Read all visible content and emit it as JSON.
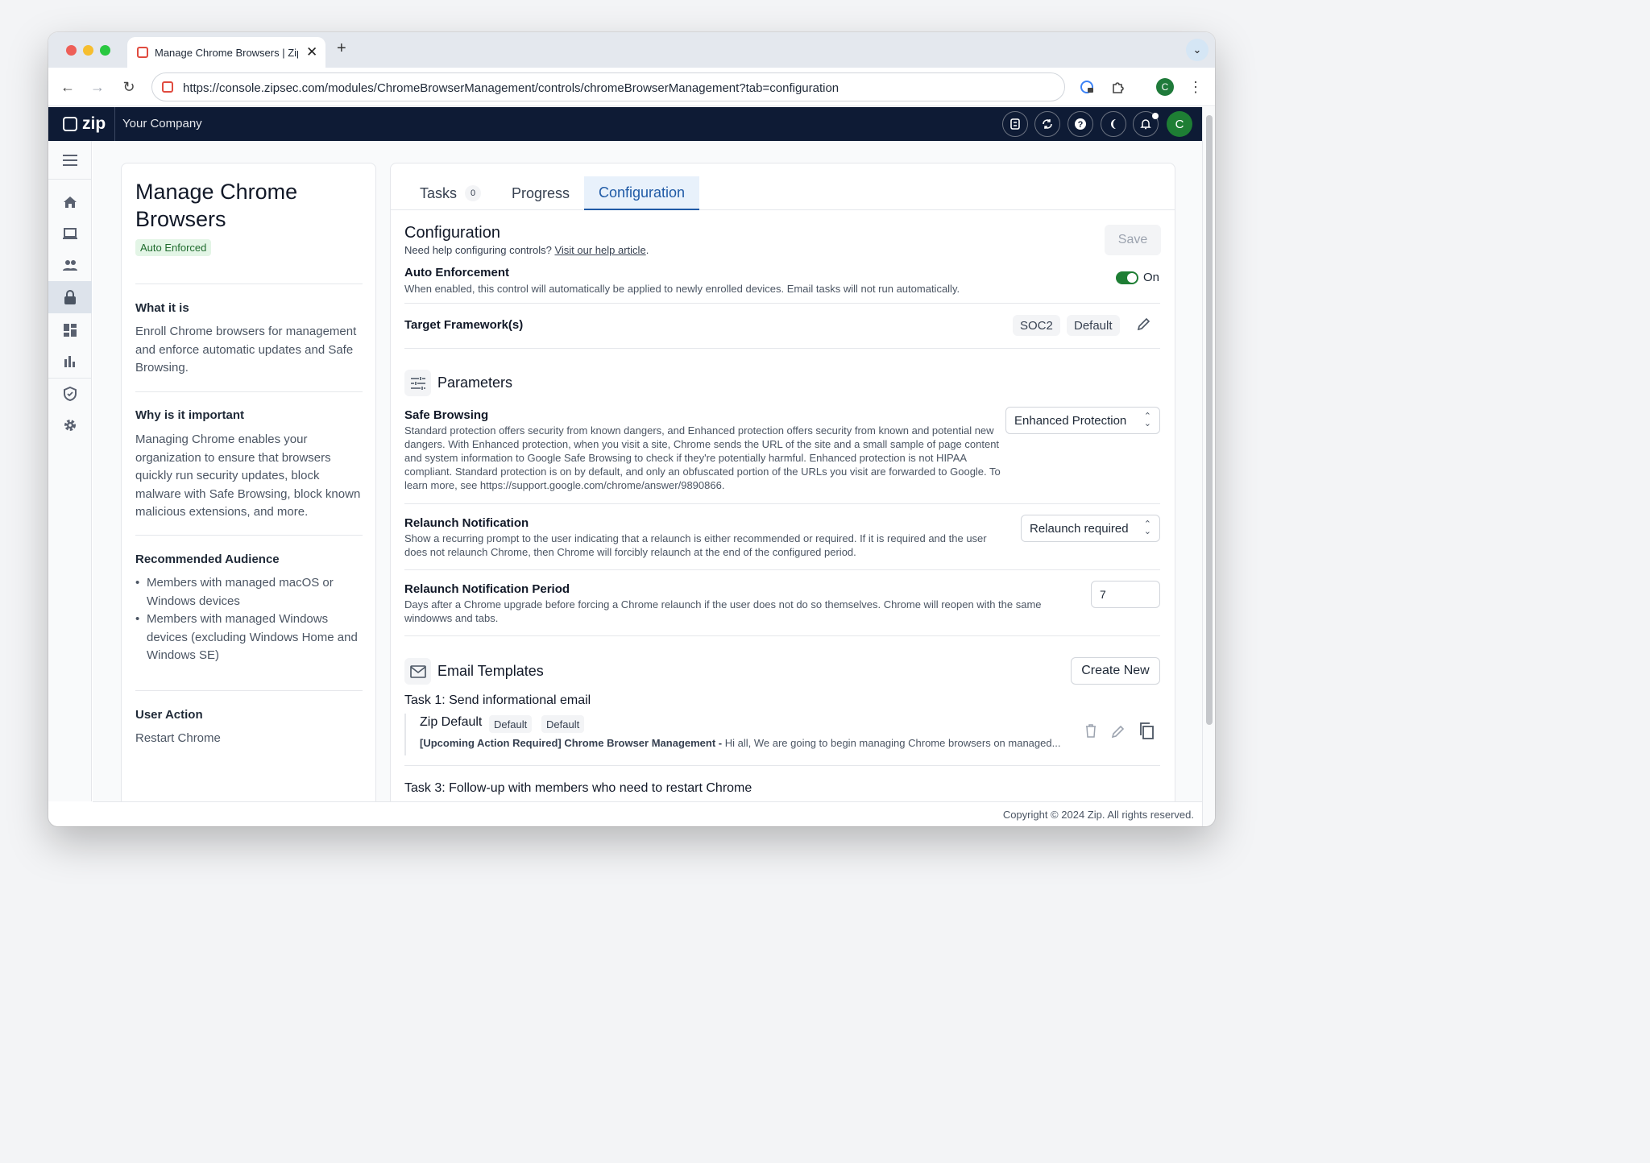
{
  "browser": {
    "tab_title": "Manage Chrome Browsers | Zip",
    "tab_close": "✕",
    "new_tab": "+",
    "url": "https://console.zipsec.com/modules/ChromeBrowserManagement/controls/chromeBrowserManagement?tab=configuration",
    "profile_initial": "C",
    "nav": {
      "back": "←",
      "forward": "→",
      "reload": "↻"
    },
    "tab_menu": "⌄"
  },
  "app": {
    "logo_text": "zip",
    "company": "Your Company",
    "user_initial": "C"
  },
  "sidebar_icons": [
    "menu-icon",
    "home-icon",
    "laptop-icon",
    "people-icon",
    "lock-icon",
    "dashboard-icon",
    "bar-chart-icon",
    "shield-icon",
    "gear-icon"
  ],
  "info": {
    "title": "Manage Chrome Browsers",
    "badge": "Auto Enforced",
    "what_title": "What it is",
    "what_body": "Enroll Chrome browsers for management and enforce automatic updates and Safe Browsing.",
    "why_title": "Why is it important",
    "why_body": "Managing Chrome enables your organization to ensure that browsers quickly run security updates, block malware with Safe Browsing, block known malicious extensions, and more.",
    "audience_title": "Recommended Audience",
    "audience": [
      "Members with managed macOS or Windows devices",
      "Members with managed Windows devices (excluding Windows Home and Windows SE)"
    ],
    "action_title": "User Action",
    "action_body": "Restart Chrome"
  },
  "tabs": {
    "tasks": "Tasks",
    "tasks_count": "0",
    "progress": "Progress",
    "configuration": "Configuration"
  },
  "config": {
    "title": "Configuration",
    "help_prefix": "Need help configuring controls?",
    "help_link": "Visit our help article",
    "help_suffix": ".",
    "save": "Save",
    "auto_title": "Auto Enforcement",
    "auto_desc": "When enabled, this control will automatically be applied to newly enrolled devices. Email tasks will not run automatically.",
    "auto_state": "On",
    "auto_enabled": true,
    "framework_title": "Target Framework(s)",
    "frameworks": [
      "SOC2",
      "Default"
    ],
    "params_title": "Parameters",
    "safe_title": "Safe Browsing",
    "safe_desc": "Standard protection offers security from known dangers, and Enhanced protection offers security from known and potential new dangers. With Enhanced protection, when you visit a site, Chrome sends the URL of the site and a small sample of page content and system information to Google Safe Browsing to check if they're potentially harmful. Enhanced protection is not HIPAA compliant. Standard protection is on by default, and only an obfuscated portion of the URLs you visit are forwarded to Google. To learn more, see https://support.google.com/chrome/answer/9890866.",
    "safe_value": "Enhanced Protection",
    "relaunch_title": "Relaunch Notification",
    "relaunch_desc": "Show a recurring prompt to the user indicating that a relaunch is either recommended or required. If it is required and the user does not relaunch Chrome, then Chrome will forcibly relaunch at the end of the configured period.",
    "relaunch_value": "Relaunch required",
    "period_title": "Relaunch Notification Period",
    "period_desc": "Days after a Chrome upgrade before forcing a Chrome relaunch if the user does not do so themselves. Chrome will reopen with the same windowws and tabs.",
    "period_value": "7",
    "email_title": "Email Templates",
    "create_new": "Create New",
    "task1_title": "Task 1: Send informational email",
    "tpl_name": "Zip Default",
    "tpl_badge1": "Default",
    "tpl_badge2": "Default",
    "tpl_subject": "[Upcoming Action Required] Chrome Browser Management -",
    "tpl_body": " Hi all, We are going to begin managing Chrome browsers on managed...",
    "task3_title": "Task 3: Follow-up with members who need to restart Chrome"
  },
  "footer": {
    "copyright": "Copyright © 2024 Zip. All rights reserved."
  },
  "colors": {
    "appbar": "#0e1b35",
    "accent": "#1f5aa6",
    "toggle_on": "#1e7e34",
    "badge_bg": "#e3f5e6"
  }
}
